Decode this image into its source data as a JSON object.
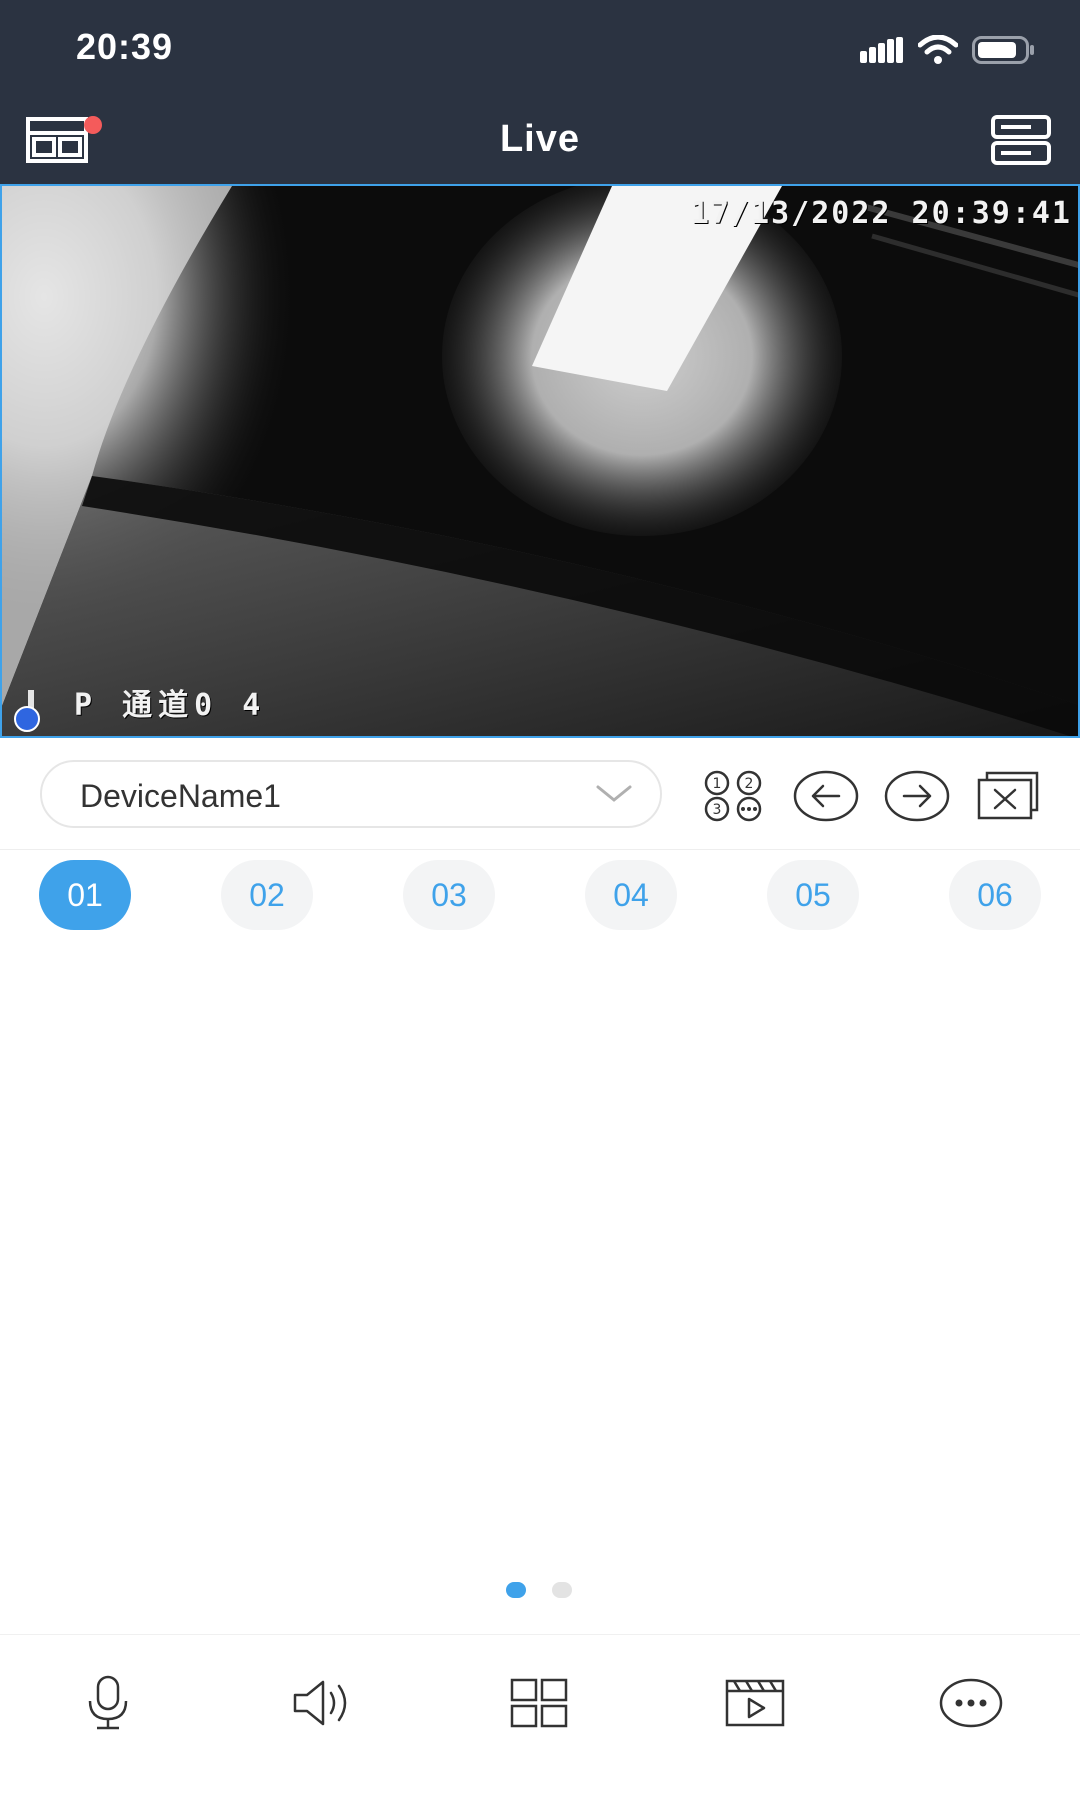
{
  "status_bar": {
    "time": "20:39"
  },
  "header": {
    "title": "Live"
  },
  "video": {
    "timestamp": "17/13/2022 20:39:41",
    "channel_label": "P 通道0 4"
  },
  "device_selector": {
    "value": "DeviceName1"
  },
  "channels": [
    {
      "label": "01",
      "active": true
    },
    {
      "label": "02",
      "active": false
    },
    {
      "label": "03",
      "active": false
    },
    {
      "label": "04",
      "active": false
    },
    {
      "label": "05",
      "active": false
    },
    {
      "label": "06",
      "active": false
    }
  ],
  "pagination": {
    "pages": 2,
    "current": 1
  },
  "colors": {
    "header_bg": "#2b3341",
    "accent": "#3fa2ea",
    "notification": "#f45b5b"
  },
  "toolbar_icons": [
    "microphone-icon",
    "speaker-icon",
    "grid-layout-icon",
    "playback-icon",
    "more-icon"
  ]
}
